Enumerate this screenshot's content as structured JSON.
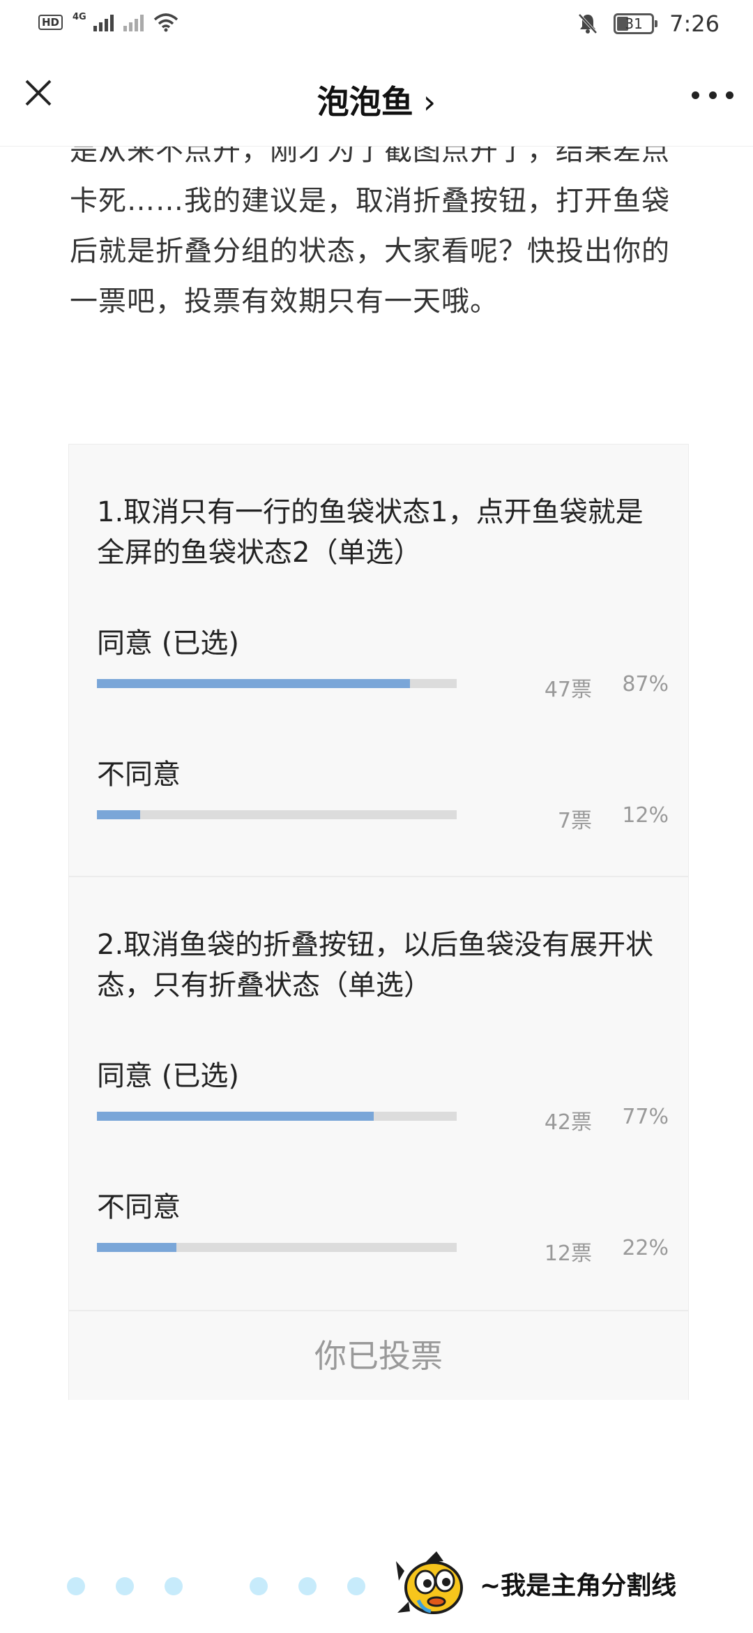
{
  "status_bar": {
    "hd_label": "HD",
    "network_label": "4G",
    "battery_level": "31",
    "time": "7:26"
  },
  "nav": {
    "title": "泡泡鱼",
    "title_chevron": "›"
  },
  "article": {
    "lines": [
      "是从来不点开，刚才为了截图点开了，结果差点",
      "卡死……我的建议是，取消折叠按钮，打开鱼袋",
      "后就是折叠分组的状态，大家看呢？快投出你的",
      "一票吧，投票有效期只有一天哦。"
    ]
  },
  "poll": {
    "questions": [
      {
        "title": "1.取消只有一行的鱼袋状态1，点开鱼袋就是全屏的鱼袋状态2（单选）",
        "options": [
          {
            "label": "同意 (已选)",
            "votes": "47票",
            "percent": "87%",
            "fraction": 0.87
          },
          {
            "label": "不同意",
            "votes": "7票",
            "percent": "12%",
            "fraction": 0.12
          }
        ]
      },
      {
        "title": "2.取消鱼袋的折叠按钮，以后鱼袋没有展开状态，只有折叠状态（单选）",
        "options": [
          {
            "label": "同意 (已选)",
            "votes": "42票",
            "percent": "77%",
            "fraction": 0.77
          },
          {
            "label": "不同意",
            "votes": "12票",
            "percent": "22%",
            "fraction": 0.22
          }
        ]
      }
    ],
    "voted_label": "你已投票"
  },
  "divider": {
    "text": "~我是主角分割线"
  },
  "colors": {
    "bar_fill": "#7aa6d8",
    "bar_track": "#dcdcdc",
    "dot": "#c7ebfb"
  }
}
